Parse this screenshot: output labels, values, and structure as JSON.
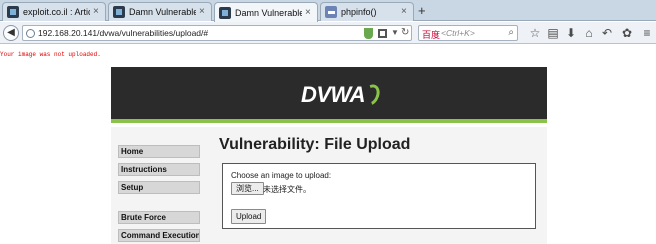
{
  "browser": {
    "tabs": [
      {
        "title": "exploit.co.il : Articles : Tu...",
        "active": false,
        "favicon": "site-favicon"
      },
      {
        "title": "Damn Vulnerable Web A...",
        "active": false,
        "favicon": "dvwa-favicon"
      },
      {
        "title": "Damn Vulnerable Web A...",
        "active": true,
        "favicon": "dvwa-favicon"
      },
      {
        "title": "phpinfo()",
        "active": false,
        "favicon": "php-favicon"
      }
    ],
    "new_tab_label": "+",
    "url": "192.168.20.141/dvwa/vulnerabilities/upload/#",
    "search_engine_label": "百度",
    "search_placeholder": "<Ctrl+K>",
    "icons": [
      "back-icon",
      "globe-icon",
      "shield-icon",
      "qr-icon",
      "dropdown-icon",
      "reload-icon",
      "search-icon",
      "star-icon",
      "reading-list-icon",
      "download-icon",
      "home-icon",
      "back-history-icon",
      "addon-icon",
      "menu-icon"
    ]
  },
  "page": {
    "error_message": "Your image was not uploaded.",
    "logo_text": "DVWA",
    "menu": [
      "Home",
      "Instructions",
      "Setup",
      "Brute Force",
      "Command Execution"
    ],
    "title": "Vulnerability: File Upload",
    "upload_form": {
      "label": "Choose an image to upload:",
      "browse_label": "浏览...",
      "no_file_text": "未选择文件。",
      "submit_label": "Upload"
    }
  },
  "colors": {
    "header_bg": "#2b2b2b",
    "accent": "#8bc34a",
    "error": "#e00000"
  }
}
